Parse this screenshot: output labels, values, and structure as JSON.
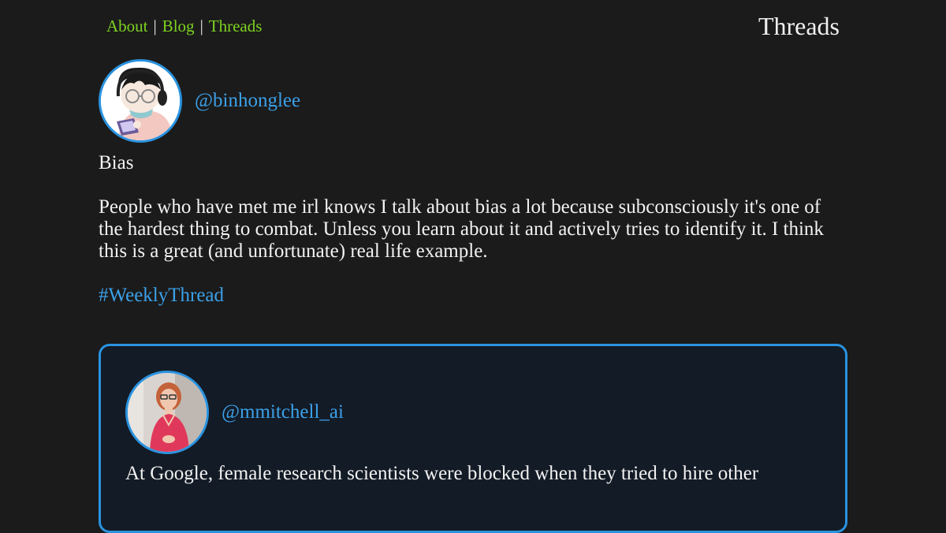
{
  "nav": {
    "about": "About",
    "blog": "Blog",
    "threads": "Threads",
    "separator": "|"
  },
  "page": {
    "title": "Threads"
  },
  "post": {
    "handle": "@binhonglee",
    "title": "Bias",
    "body": "People who have met me irl knows I talk about bias a lot because subconsciously it's one of the hardest thing to combat. Unless you learn about it and actively tries to identify it. I think this is a great (and unfortunate) real life example.",
    "hashtag": "#WeeklyThread"
  },
  "quoted_post": {
    "handle": "@mmitchell_ai",
    "text_partial": "At Google, female research scientists were blocked when they tried to hire other"
  },
  "colors": {
    "background": "#1b1b1b",
    "nav_link": "#7ed321",
    "accent_blue": "#2a93df",
    "quote_background": "#131b26"
  }
}
